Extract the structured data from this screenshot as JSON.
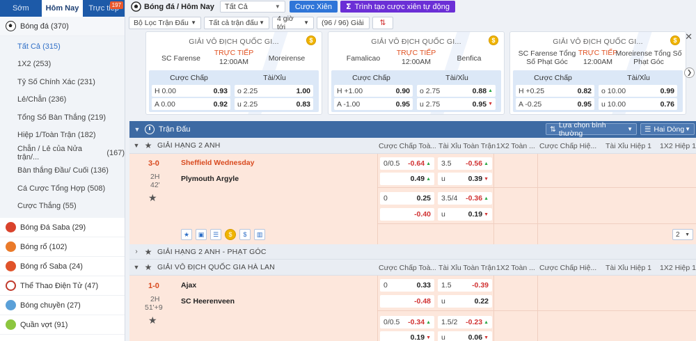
{
  "sidebar": {
    "tabs": [
      {
        "label": "Sớm"
      },
      {
        "label": "Hôm Nay"
      },
      {
        "label": "Trực tiếp",
        "badge": "197"
      }
    ],
    "main_sport": {
      "label": "Bóng đá",
      "count": "(370)"
    },
    "sub_items": [
      {
        "label": "Tất Cả",
        "count": "(315)"
      },
      {
        "label": "1X2",
        "count": "(253)"
      },
      {
        "label": "Tỷ Số Chính Xác",
        "count": "(231)"
      },
      {
        "label": "Lẻ/Chẵn",
        "count": "(236)"
      },
      {
        "label": "Tổng Số Bàn Thắng",
        "count": "(219)"
      },
      {
        "label": "Hiệp 1/Toàn Trận",
        "count": "(182)"
      },
      {
        "label": "Chẵn / Lẻ của Nửa trận/...",
        "count": "(167)"
      },
      {
        "label": "Bàn thắng Đầu/ Cuối",
        "count": "(136)"
      },
      {
        "label": "Cá Cược Tổng Hợp",
        "count": "(508)"
      },
      {
        "label": "Cược Thắng",
        "count": "(55)"
      }
    ],
    "sports": [
      {
        "label": "Bóng Đá Saba",
        "count": "(29)",
        "icon": "soccer-saba-icon",
        "color": "#d9432c"
      },
      {
        "label": "Bóng rổ",
        "count": "(102)",
        "icon": "basketball-icon",
        "color": "#ea7a2a"
      },
      {
        "label": "Bóng rổ Saba",
        "count": "(24)",
        "icon": "basketball-saba-icon",
        "color": "#e0532a"
      },
      {
        "label": "Thể Thao Điện Tử",
        "count": "(47)",
        "icon": "esports-icon",
        "color": "#c0392b"
      },
      {
        "label": "Bóng chuyền",
        "count": "(27)",
        "icon": "volleyball-icon",
        "color": "#5aa0d8"
      },
      {
        "label": "Quần vợt",
        "count": "(91)",
        "icon": "tennis-icon",
        "color": "#8cc63f"
      }
    ]
  },
  "topbar": {
    "crumb": "Bóng đá / Hôm Nay",
    "select_value": "Tất Cả",
    "parlay_label": "Cược Xiên",
    "auto_parlay_label": "Trình tạo cược xiên tự động"
  },
  "filters": {
    "match_filter": "Bộ Lọc Trận Đấu",
    "all_matches": "Tất cả trận đấu",
    "hours": "4 giờ tới",
    "count": "(96 / 96) Giải"
  },
  "cards": [
    {
      "title": "GIẢI VÔ ĐỊCH QUỐC GI...",
      "home": "SC Farense",
      "away": "Moreirense",
      "live": "TRỰC TIẾP",
      "time": "12:00AM",
      "hdr_hcp": "Cược Chấp",
      "hdr_ou": "Tài/Xỉu",
      "r1": {
        "hl": "H 0.00",
        "hv": "0.93",
        "ol": "o 2.25",
        "ov": "1.00"
      },
      "r2": {
        "hl": "A 0.00",
        "hv": "0.92",
        "ol": "u 2.25",
        "ov": "0.83"
      }
    },
    {
      "title": "GIẢI VÔ ĐỊCH QUỐC GI...",
      "home": "Famalicao",
      "away": "Benfica",
      "live": "TRỰC TIẾP",
      "time": "12:00AM",
      "hdr_hcp": "Cược Chấp",
      "hdr_ou": "Tài/Xỉu",
      "r1": {
        "hl": "H +1.00",
        "hv": "0.90",
        "ol": "o 2.75",
        "ov": "0.88"
      },
      "r2": {
        "hl": "A -1.00",
        "hv": "0.95",
        "ol": "u 2.75",
        "ov": "0.95"
      }
    },
    {
      "title": "GIẢI VÔ ĐỊCH QUỐC GI...",
      "home": "SC Farense Tổng Số Phạt Góc",
      "away": "Moreirense Tổng Số Phạt Góc",
      "live": "TRỰC TIẾP",
      "time": "12:00AM",
      "hdr_hcp": "Cược Chấp",
      "hdr_ou": "Tài/Xỉu",
      "r1": {
        "hl": "H +0.25",
        "hv": "0.82",
        "ol": "o 10.00",
        "ov": "0.99"
      },
      "r2": {
        "hl": "A -0.25",
        "hv": "0.95",
        "ol": "u 10.00",
        "ov": "0.76"
      }
    }
  ],
  "table": {
    "title": "Trận Đấu",
    "sort_label": "Lựa chọn bình thường",
    "view_label": "Hai Dòng",
    "columns": [
      "Cược Chấp Toà...",
      "Tài Xỉu Toàn Trận",
      "1X2 Toàn ...",
      "Cược Chấp Hiệ...",
      "Tài Xỉu Hiệp 1",
      "1X2 Hiệp 1"
    ],
    "league1": "GIẢI HẠNG 2 ANH",
    "match1": {
      "score": "3-0",
      "period": "2H",
      "minute": "42'",
      "home": "Sheffield Wednesday",
      "away": "Plymouth Argyle",
      "a1": {
        "hl": "0/0.5",
        "hv": "-0.64",
        "ol": "3.5",
        "ov": "-0.56"
      },
      "a2": {
        "hl": "",
        "hv": "0.49",
        "ol": "u",
        "ov": "0.39"
      },
      "b1": {
        "hl": "0",
        "hv": "0.25",
        "ol": "3.5/4",
        "ov": "-0.36"
      },
      "b2": {
        "hl": "",
        "hv": "-0.40",
        "ol": "u",
        "ov": "0.19"
      },
      "pager": "2"
    },
    "league2": "GIẢI HẠNG 2 ANH - PHẠT GÓC",
    "league3": "GIẢI VÔ ĐỊCH QUỐC GIA HÀ LAN",
    "match2": {
      "score": "1-0",
      "period": "2H",
      "minute": "51'+9",
      "home": "Ajax",
      "away": "SC Heerenveen",
      "a1": {
        "hl": "0",
        "hv": "0.33",
        "ol": "1.5",
        "ov": "-0.39"
      },
      "a2": {
        "hl": "",
        "hv": "-0.48",
        "ol": "u",
        "ov": "0.22"
      },
      "b1": {
        "hl": "0/0.5",
        "hv": "-0.34",
        "ol": "1.5/2",
        "ov": "-0.23"
      },
      "b2": {
        "hl": "",
        "hv": "0.19",
        "ol": "u",
        "ov": "0.06"
      }
    }
  },
  "colors": {
    "primary": "#1d5aa8",
    "accent_orange": "#d84a1f",
    "purple": "#6b2fd6",
    "row_bg": "#fde7dc"
  }
}
